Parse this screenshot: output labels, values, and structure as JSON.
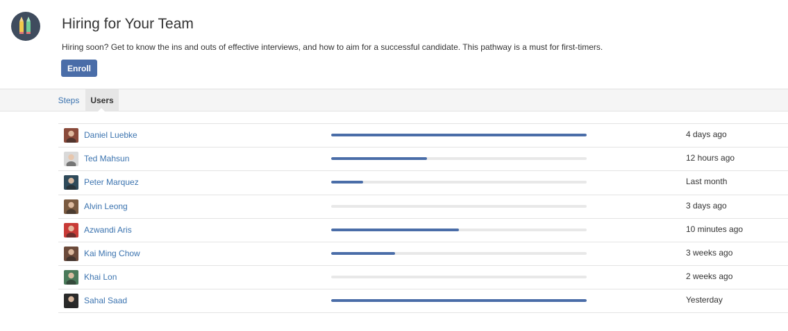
{
  "pathway": {
    "title": "Hiring for Your Team",
    "description": "Hiring soon? Get to know the ins and outs of effective interviews, and how to aim for a successful candidate. This pathway is a must for first-timers.",
    "enroll_label": "Enroll",
    "logo_icon": "pencils-icon"
  },
  "tabs": [
    {
      "label": "Steps",
      "active": false
    },
    {
      "label": "Users",
      "active": true
    }
  ],
  "colors": {
    "accent": "#4a6da8",
    "link": "#3b73af",
    "bar_track": "#e8e8e8",
    "logo_bg": "#3f4c5e"
  },
  "users": [
    {
      "name": "Daniel Luebke",
      "progress": 1.0,
      "last_active": "4 days ago",
      "avatar_color": "#8a4a3a"
    },
    {
      "name": "Ted Mahsun",
      "progress": 0.375,
      "last_active": "12 hours ago",
      "avatar_color": "#d9d9d9"
    },
    {
      "name": "Peter Marquez",
      "progress": 0.125,
      "last_active": "Last month",
      "avatar_color": "#2f4a5a"
    },
    {
      "name": "Alvin Leong",
      "progress": 0.0,
      "last_active": "3 days ago",
      "avatar_color": "#7a5a40"
    },
    {
      "name": "Azwandi Aris",
      "progress": 0.5,
      "last_active": "10 minutes ago",
      "avatar_color": "#c83a36"
    },
    {
      "name": "Kai Ming Chow",
      "progress": 0.25,
      "last_active": "3 weeks ago",
      "avatar_color": "#6b4a3a"
    },
    {
      "name": "Khai Lon",
      "progress": 0.0,
      "last_active": "2 weeks ago",
      "avatar_color": "#4a7a5a"
    },
    {
      "name": "Sahal Saad",
      "progress": 1.0,
      "last_active": "Yesterday",
      "avatar_color": "#2a2a2a"
    }
  ]
}
